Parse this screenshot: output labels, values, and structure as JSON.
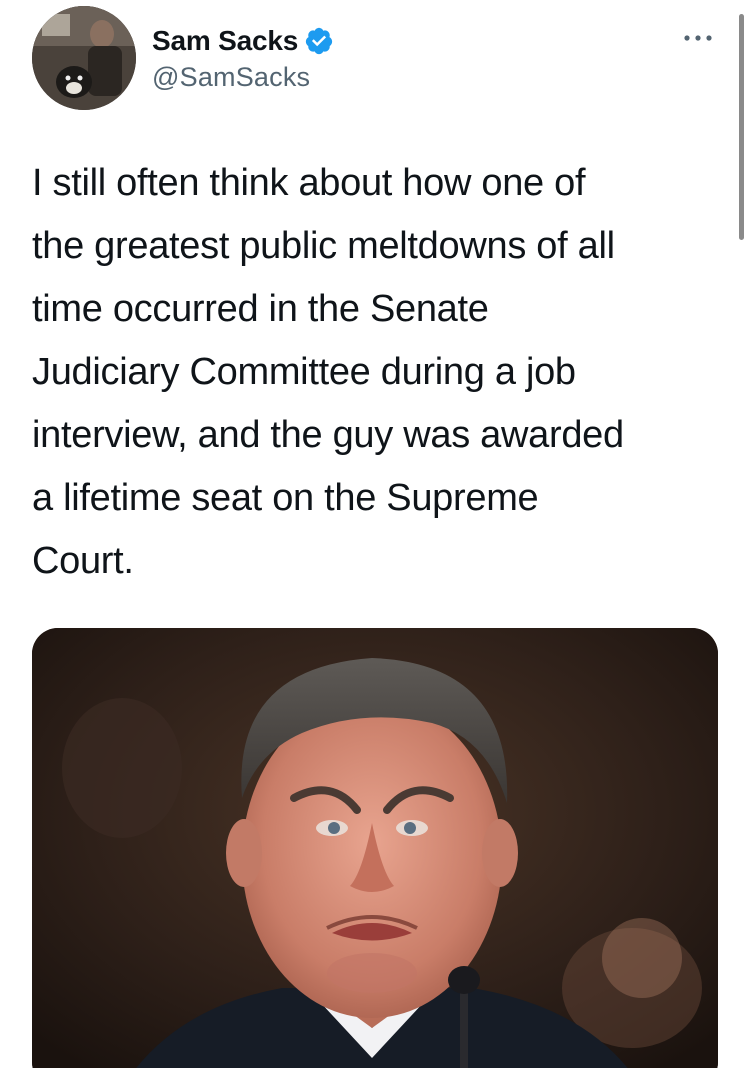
{
  "tweet": {
    "author": {
      "display_name": "Sam Sacks",
      "handle": "@SamSacks",
      "verified": true,
      "verified_color": "#1d9bf0"
    },
    "more_icon": "more-horizontal-icon",
    "text_lines": [
      "I still often think about how one of",
      "the greatest public meltdowns of all",
      "time occurred in the Senate",
      "Judiciary Committee during a job",
      "interview, and the guy was awarded",
      "a lifetime seat on the Supreme",
      "Court."
    ]
  },
  "colors": {
    "text_primary": "#0f1419",
    "text_secondary": "#536471",
    "background": "#ffffff"
  }
}
